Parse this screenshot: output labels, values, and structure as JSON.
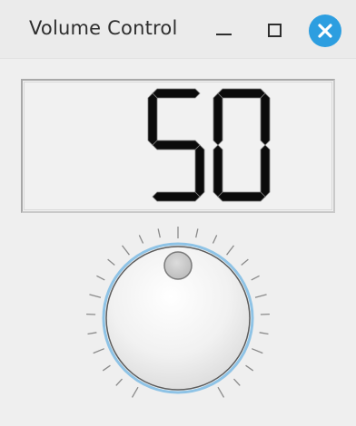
{
  "window": {
    "title": "Volume Control",
    "buttons": [
      {
        "name": "minimize-button",
        "icon": "minimize-icon"
      },
      {
        "name": "maximize-button",
        "icon": "maximize-icon"
      },
      {
        "name": "close-button",
        "icon": "close-icon"
      }
    ]
  },
  "display": {
    "value": "50"
  },
  "dial": {
    "value": 50,
    "min": 0,
    "max": 100,
    "notches": 24
  },
  "colors": {
    "accent": "#2d9ee0",
    "dial_ring": "#8ec3e6",
    "lcd_segment": "#0b0b0b"
  }
}
